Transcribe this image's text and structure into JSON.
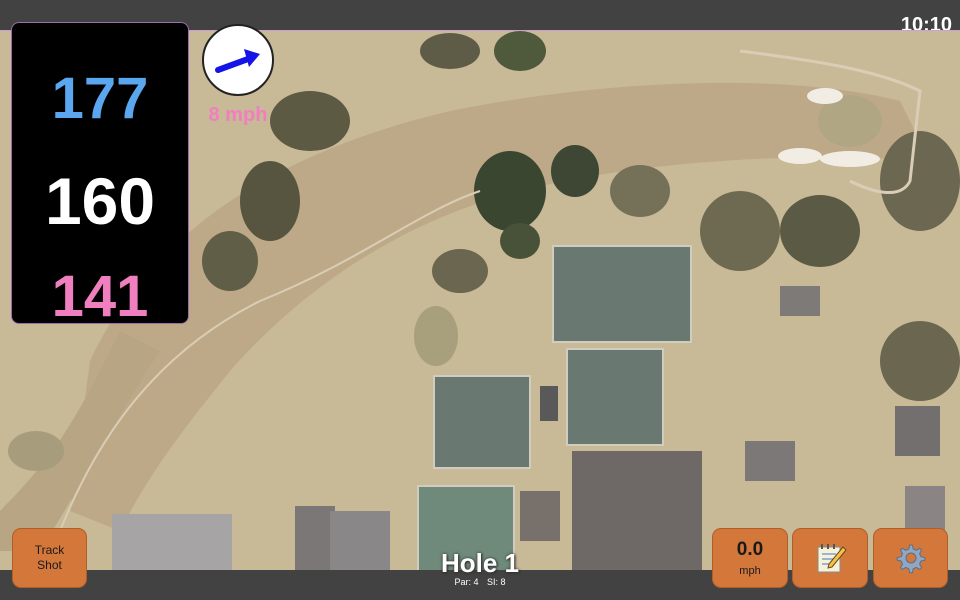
{
  "status_bar": {
    "time": "10:10"
  },
  "distances": {
    "back": "177",
    "middle": "160",
    "front": "141",
    "colors": {
      "back": "#5aa7f0",
      "middle": "#ffffff",
      "front": "#f07fbf"
    }
  },
  "wind": {
    "speed_label": "8 mph",
    "icon": "arrow-icon",
    "color": "#1414e6",
    "label_color": "#f07fbf"
  },
  "hole": {
    "title": "Hole 1",
    "par": "Par: 4",
    "si": "SI: 8"
  },
  "buttons": {
    "track_shot_line1": "Track",
    "track_shot_line2": "Shot",
    "speed_value": "0.0",
    "speed_unit": "mph",
    "notes_icon": "notepad-icon",
    "settings_icon": "gear-icon",
    "color": "#d4773a"
  }
}
